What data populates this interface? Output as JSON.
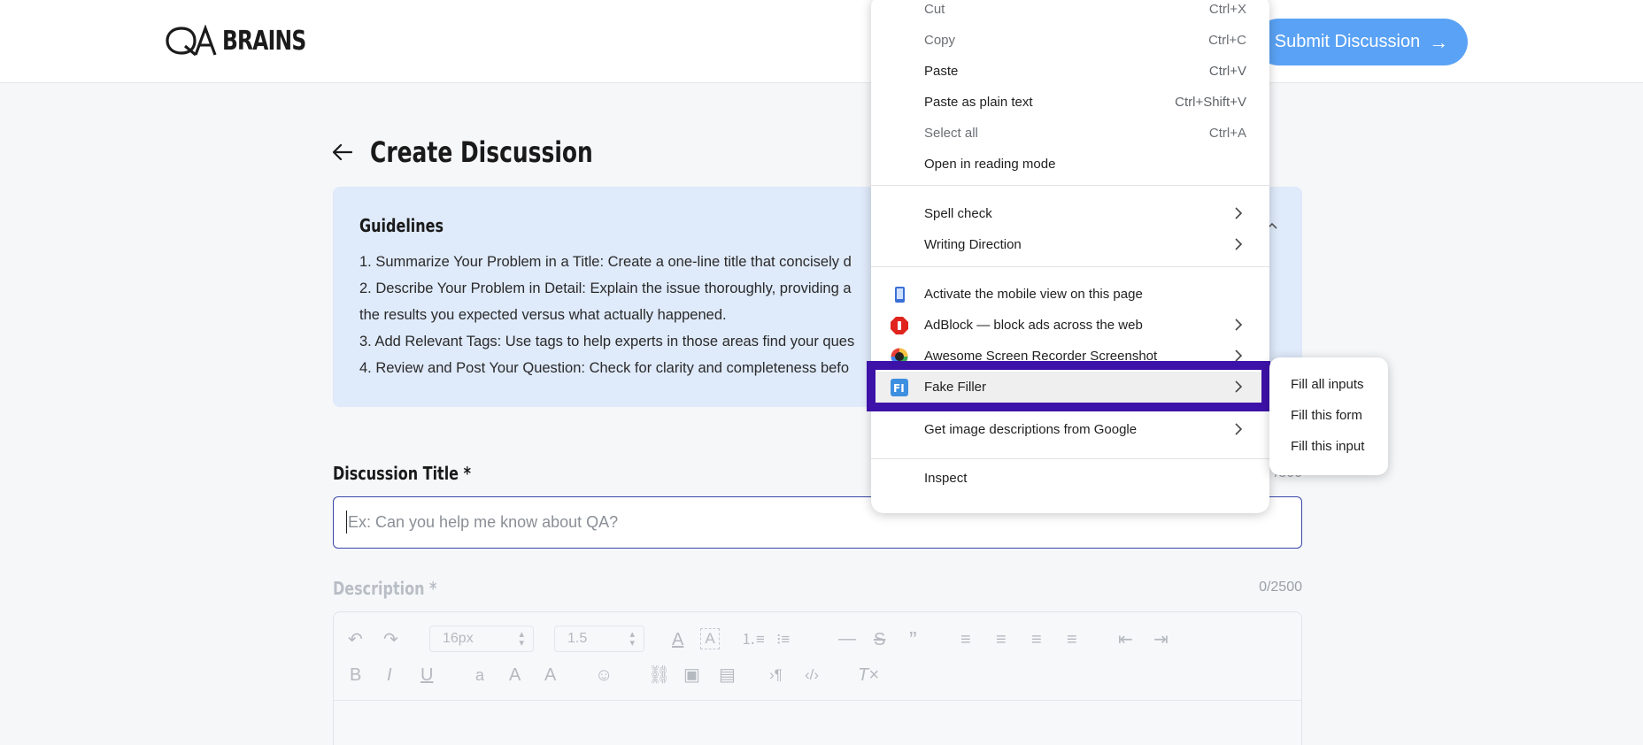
{
  "header": {
    "logo_text": "BRAINS",
    "submit_label": "Submit Discussion"
  },
  "page": {
    "title": "Create Discussion"
  },
  "guidelines": {
    "heading": "Guidelines",
    "lines": [
      "1. Summarize Your Problem in a Title: Create a one-line title that concisely d",
      "2. Describe Your Problem in Detail: Explain the issue thoroughly, providing a",
      "the results you expected versus what actually happened.",
      "3. Add Relevant Tags: Use tags to help experts in those areas find your ques",
      "4. Review and Post Your Question: Check for clarity and completeness befo"
    ]
  },
  "title_field": {
    "label": "Discussion Title *",
    "counter": "/300",
    "placeholder": "Ex: Can you help me know about QA?",
    "value": ""
  },
  "description_field": {
    "label": "Description *",
    "counter": "0/2500",
    "font_size": "16px",
    "line_height": "1.5"
  },
  "context_menu": {
    "items": [
      {
        "label": "Cut",
        "shortcut": "Ctrl+X",
        "dim": true
      },
      {
        "label": "Copy",
        "shortcut": "Ctrl+C",
        "dim": true
      },
      {
        "label": "Paste",
        "shortcut": "Ctrl+V",
        "dim": false
      },
      {
        "label": "Paste as plain text",
        "shortcut": "Ctrl+Shift+V",
        "dim": false
      },
      {
        "label": "Select all",
        "shortcut": "Ctrl+A",
        "dim": true
      },
      {
        "label": "Open in reading mode",
        "shortcut": "",
        "dim": false
      },
      {
        "label": "Spell check",
        "submenu": true
      },
      {
        "label": "Writing Direction",
        "submenu": true
      },
      {
        "label": "Activate the mobile view on this page",
        "icon": "mobile-view-icon"
      },
      {
        "label": "AdBlock — block ads across the web",
        "icon": "adblock-icon",
        "submenu": true
      },
      {
        "label": "Awesome Screen Recorder  Screenshot",
        "icon": "screen-recorder-icon",
        "submenu": true
      },
      {
        "label": "Fake Filler",
        "icon": "fake-filler-icon",
        "submenu": true,
        "highlighted": true
      },
      {
        "label": "Get image descriptions from Google",
        "submenu": true
      },
      {
        "label": "Inspect"
      }
    ],
    "highlight_color": "#3d12a8"
  },
  "submenu": {
    "items": [
      "Fill all inputs",
      "Fill this form",
      "Fill this input"
    ]
  },
  "colors": {
    "accent": "#5aa2f5",
    "guidelines_bg": "#dfeafa",
    "input_border": "#3a46a8"
  }
}
